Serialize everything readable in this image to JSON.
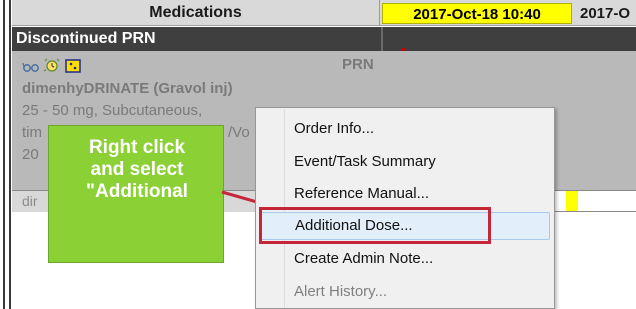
{
  "grid": {
    "header": {
      "medications_label": "Medications",
      "time_col_1": "2017-Oct-18 10:40",
      "time_col_2": "2017-O"
    },
    "section": {
      "label": "Discontinued PRN"
    },
    "medication": {
      "icons": [
        "eyeglasses-icon",
        "sun-clock-icon",
        "prn-info-icon"
      ],
      "prn_tag": "PRN",
      "name": "dimenhyDRINATE (Gravol inj)",
      "dose_line": "25 - 50 mg, Subcutaneous,",
      "frequency_line_partial": "tim",
      "frequency_line_suffix": "/Vo",
      "date_line_partial": "20",
      "sub_row_text": "dir"
    }
  },
  "callout": {
    "lines": [
      "Right click",
      "and select",
      "\"Additional"
    ],
    "color": "#8bd135"
  },
  "context_menu": {
    "items": [
      {
        "label": "Order Info...",
        "state": "normal"
      },
      {
        "label": "Event/Task Summary",
        "state": "normal"
      },
      {
        "label": "Reference Manual...",
        "state": "normal"
      },
      {
        "label": "Additional Dose...",
        "state": "highlighted"
      },
      {
        "label": "Create Admin Note...",
        "state": "normal"
      },
      {
        "label": "Alert History...",
        "state": "disabled"
      }
    ],
    "highlight_color": "#c4263a"
  },
  "colors": {
    "section_bg": "#3f3f3f",
    "time_header_bg": "#ffff00",
    "discontinued_cell_bg": "#b9b9b9"
  }
}
